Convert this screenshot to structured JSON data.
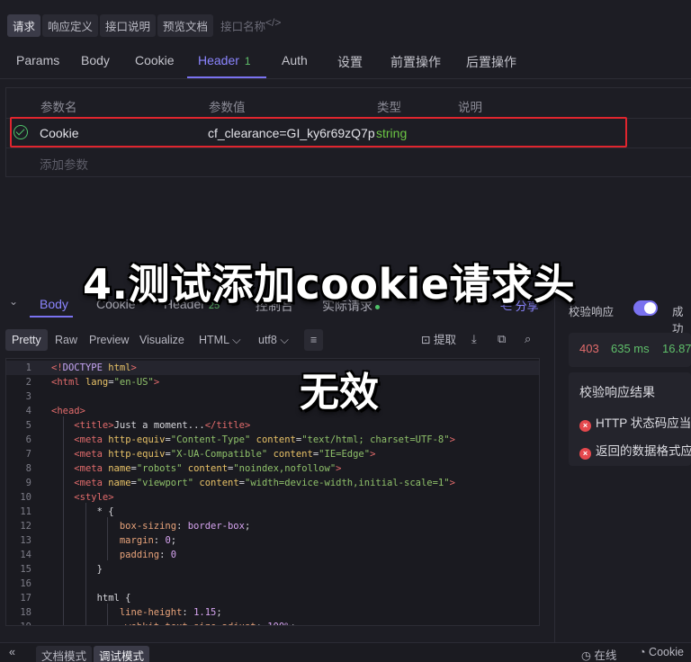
{
  "mode_tabs": [
    "请求",
    "响应定义",
    "接口说明",
    "预览文档",
    "接口名称"
  ],
  "code_toggle": "</>",
  "request_tabs": {
    "params": "Params",
    "body": "Body",
    "cookie": "Cookie",
    "header": "Header",
    "header_count": "1",
    "auth": "Auth",
    "settings": "设置",
    "pre": "前置操作",
    "post": "后置操作"
  },
  "header_table": {
    "columns": [
      "参数名",
      "参数值",
      "类型",
      "说明"
    ],
    "row": {
      "name": "Cookie",
      "value": "cf_clearance=GI_ky6r69zQ7p",
      "type": "string"
    },
    "add_label": "添加参数"
  },
  "captions": {
    "main": "4.测试添加cookie请求头",
    "sub": "无效"
  },
  "response_tabs": {
    "body": "Body",
    "cookie": "Cookie",
    "header": "Header",
    "header_count": "25",
    "console": "控制台",
    "actual": "实际请求",
    "share": "分享"
  },
  "format_bar": {
    "pretty": "Pretty",
    "raw": "Raw",
    "preview": "Preview",
    "visualize": "Visualize",
    "format": "HTML",
    "encoding": "utf8",
    "extract": "提取"
  },
  "code_lines": [
    "<!DOCTYPE html>",
    "<html lang=\"en-US\">",
    "",
    "<head>",
    "    <title>Just a moment...</title>",
    "    <meta http-equiv=\"Content-Type\" content=\"text/html; charset=UTF-8\">",
    "    <meta http-equiv=\"X-UA-Compatible\" content=\"IE=Edge\">",
    "    <meta name=\"robots\" content=\"noindex,nofollow\">",
    "    <meta name=\"viewport\" content=\"width=device-width,initial-scale=1\">",
    "    <style>",
    "        * {",
    "            box-sizing: border-box;",
    "            margin: 0;",
    "            padding: 0",
    "        }",
    "",
    "        html {",
    "            line-height: 1.15;",
    "            -webkit-text-size-adjust: 100%;"
  ],
  "right_panel": {
    "validate_label": "校验响应",
    "success_label": "成功",
    "status": "403",
    "time": "635 ms",
    "size": "16.87",
    "result_title": "校验响应结果",
    "errors": [
      "HTTP 状态码应当",
      "返回的数据格式应"
    ]
  },
  "bottom_bar": {
    "doc_mode": "文档模式",
    "debug_mode": "调试模式",
    "online": "在线",
    "cookie": "Cookie"
  },
  "colors": {
    "accent": "#7a72f0",
    "highlight_box": "#e0252e",
    "status_error": "#e36c6c",
    "success_green": "#4fc36a"
  }
}
